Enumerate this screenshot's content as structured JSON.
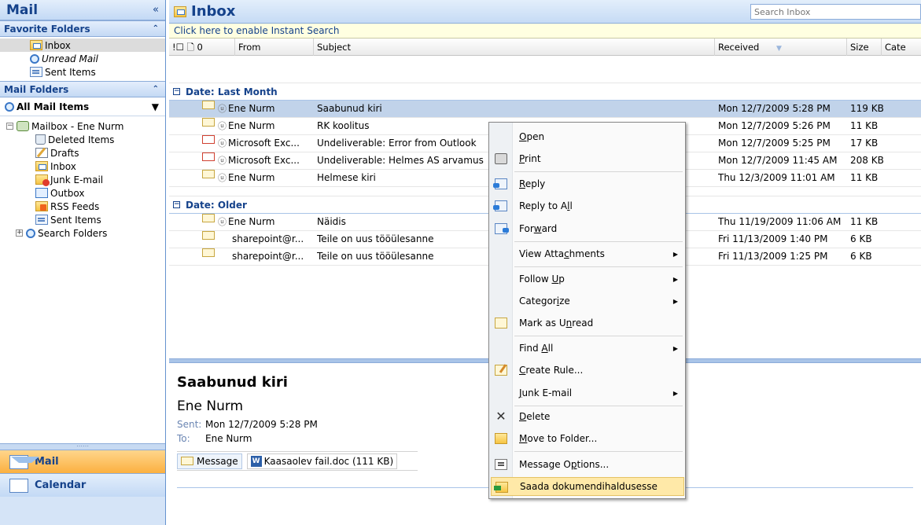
{
  "nav": {
    "title": "Mail",
    "collapse_glyph": "«",
    "favorites_header": "Favorite Folders",
    "favorites": [
      {
        "label": "Inbox",
        "icon": "inbox-icon"
      },
      {
        "label": "Unread Mail",
        "icon": "search-folder-icon"
      },
      {
        "label": "Sent Items",
        "icon": "sent-items-icon"
      }
    ],
    "mail_folders_header": "Mail Folders",
    "all_mail_items": "All Mail Items",
    "mailbox": "Mailbox - Ene Nurm",
    "folders": [
      {
        "label": "Deleted Items",
        "icon": "trash-icon"
      },
      {
        "label": "Drafts",
        "icon": "drafts-icon"
      },
      {
        "label": "Inbox",
        "icon": "inbox-icon"
      },
      {
        "label": "Junk E-mail",
        "icon": "junk-icon"
      },
      {
        "label": "Outbox",
        "icon": "outbox-icon"
      },
      {
        "label": "RSS Feeds",
        "icon": "rss-icon"
      },
      {
        "label": "Sent Items",
        "icon": "sent-items-icon"
      }
    ],
    "search_folders": "Search Folders",
    "buttons": {
      "mail": "Mail",
      "calendar": "Calendar"
    }
  },
  "main": {
    "title": "Inbox",
    "search_placeholder": "Search Inbox",
    "instant_search": "Click here to enable Instant Search",
    "columns": {
      "icons": "!☐ 🗋 0",
      "from": "From",
      "subject": "Subject",
      "received": "Received",
      "size": "Size",
      "categories": "Cate"
    },
    "groups": [
      {
        "label": "Date: Last Month",
        "rows": [
          {
            "from": "Ene Nurm",
            "subject": "Saabunud kiri",
            "received": "Mon 12/7/2009 5:28 PM",
            "size": "119 KB",
            "status": "read"
          },
          {
            "from": "Ene Nurm",
            "subject": "RK koolitus",
            "received": "Mon 12/7/2009 5:26 PM",
            "size": "11 KB",
            "status": "read"
          },
          {
            "from": "Microsoft Exc...",
            "subject": "Undeliverable: Error from Outlook",
            "received": "Mon 12/7/2009 5:25 PM",
            "size": "17 KB",
            "status": "error"
          },
          {
            "from": "Microsoft Exc...",
            "subject": "Undeliverable: Helmes AS arvamus",
            "received": "Mon 12/7/2009 11:45 AM",
            "size": "208 KB",
            "status": "error"
          },
          {
            "from": "Ene Nurm",
            "subject": "Helmese kiri",
            "received": "Thu 12/3/2009 11:01 AM",
            "size": "11 KB",
            "status": "read"
          }
        ]
      },
      {
        "label": "Date: Older",
        "rows": [
          {
            "from": "Ene Nurm",
            "subject": "Näidis",
            "received": "Thu 11/19/2009 11:06 AM",
            "size": "11 KB",
            "status": "read"
          },
          {
            "from": "sharepoint@r...",
            "subject": "Teile on uus tööülesanne",
            "received": "Fri 11/13/2009 1:40 PM",
            "size": "6 KB",
            "status": "read"
          },
          {
            "from": "sharepoint@r...",
            "subject": "Teile on uus tööülesanne",
            "received": "Fri 11/13/2009 1:25 PM",
            "size": "6 KB",
            "status": "read"
          }
        ]
      }
    ]
  },
  "reading": {
    "subject": "Saabunud kiri",
    "from": "Ene Nurm",
    "sent_label": "Sent:",
    "sent_value": "Mon 12/7/2009 5:28 PM",
    "to_label": "To:",
    "to_value": "Ene Nurm",
    "message_tab": "Message",
    "attachment": "Kaasaolev fail.doc (111 KB)"
  },
  "context_menu": [
    {
      "label": "Open",
      "icon": "",
      "submenu": false
    },
    {
      "label": "Print",
      "icon": "print-icon",
      "submenu": false
    },
    {
      "label": "Reply",
      "icon": "reply-icon",
      "submenu": false
    },
    {
      "label": "Reply to All",
      "icon": "reply-all-icon",
      "submenu": false
    },
    {
      "label": "Forward",
      "icon": "forward-icon",
      "submenu": false
    },
    {
      "label": "View Attachments",
      "icon": "",
      "submenu": true
    },
    {
      "label": "Follow Up",
      "icon": "",
      "submenu": true
    },
    {
      "label": "Categorize",
      "icon": "",
      "submenu": true
    },
    {
      "label": "Mark as Unread",
      "icon": "mark-unread-icon",
      "submenu": false
    },
    {
      "label": "Find All",
      "icon": "",
      "submenu": true
    },
    {
      "label": "Create Rule...",
      "icon": "create-rule-icon",
      "submenu": false
    },
    {
      "label": "Junk E-mail",
      "icon": "",
      "submenu": true
    },
    {
      "label": "Delete",
      "icon": "delete-icon",
      "submenu": false
    },
    {
      "label": "Move to Folder...",
      "icon": "move-folder-icon",
      "submenu": false
    },
    {
      "label": "Message Options...",
      "icon": "message-options-icon",
      "submenu": false
    },
    {
      "label": "Saada dokumendihaldusesse",
      "icon": "send-to-dms-icon",
      "submenu": false,
      "highlighted": true
    }
  ]
}
